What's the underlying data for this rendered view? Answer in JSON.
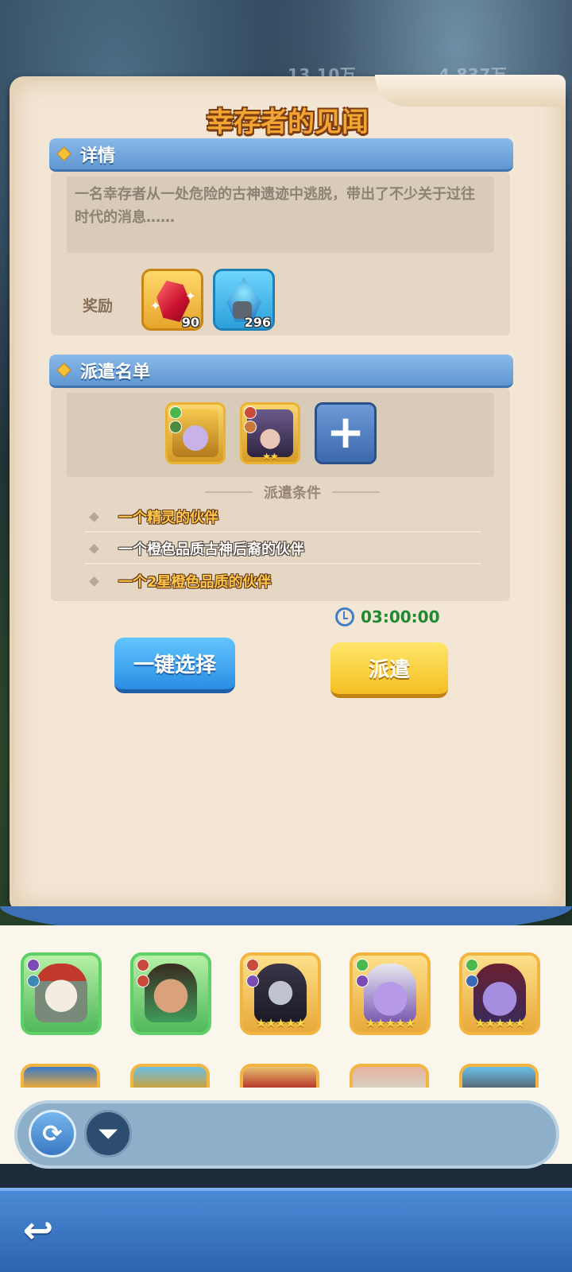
{
  "resources": {
    "left_amount": "13.10万",
    "right_amount": "4,837万"
  },
  "panel": {
    "title": "幸存者的见闻"
  },
  "details": {
    "header": "详情",
    "description": "一名幸存者从一处危险的古神遗迹中逃脱，带出了不少关于过往时代的消息……",
    "reward_label": "奖励",
    "rewards": [
      {
        "icon": "ruby-gem-icon",
        "count": "90"
      },
      {
        "icon": "blue-stone-icon",
        "count": "296"
      }
    ]
  },
  "dispatch": {
    "header": "派遣名单",
    "add_label": "+",
    "conditions_title": "派遣条件",
    "conditions": [
      {
        "text": "一个精灵的伙伴",
        "met": true
      },
      {
        "text": "一个橙色品质古神后裔的伙伴",
        "met": false
      },
      {
        "text": "一个2星橙色品质的伙伴",
        "met": true
      }
    ],
    "timer": "03:00:00",
    "auto_select_label": "一键选择",
    "dispatch_label": "派遣"
  },
  "roster": {
    "colors": {
      "gold_frame": "#f3b541",
      "green_frame": "#5fcf67"
    },
    "row1": [
      {
        "name": "skeleton-pirate",
        "frame": "green",
        "stars": ""
      },
      {
        "name": "warrior-girl",
        "frame": "green",
        "stars": ""
      },
      {
        "name": "dark-knight",
        "frame": "gold",
        "stars": "★★★★★"
      },
      {
        "name": "purple-imp",
        "frame": "gold",
        "stars": "★★★★★"
      },
      {
        "name": "vampire-girl",
        "frame": "gold",
        "stars": "★★★★★"
      }
    ]
  },
  "toolbar": {
    "refresh_icon": "⟳",
    "filter_icon": "⏷"
  },
  "nav": {
    "back_icon": "↩"
  }
}
